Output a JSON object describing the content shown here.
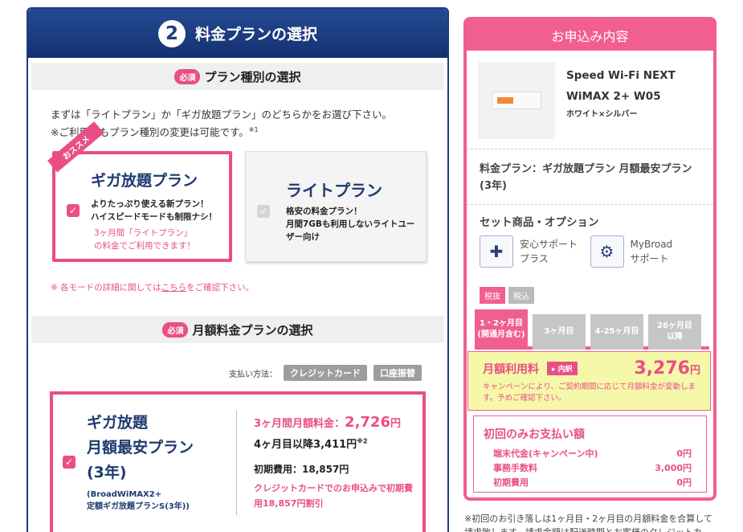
{
  "step": {
    "number": "2",
    "title": "料金プランの選択"
  },
  "plan_type_section": {
    "required_badge": "必須",
    "heading": "プラン種別の選択",
    "intro_line1": "まずは「ライトプラン」か「ギガ放題プラン」のどちらかをお選び下さい。",
    "intro_line2": "※ご利用中もプラン種別の変更は可能です。",
    "intro_sup": "※1",
    "giga": {
      "ribbon": "おススメ",
      "title": "ギガ放題プラン",
      "desc1": "よりたっぷり使える新プラン！",
      "desc2": "ハイスピードモードも制限ナシ！",
      "note1": "3ヶ月間「ライトプラン」",
      "note2": "の料金でご利用できます！",
      "selected": true
    },
    "lite": {
      "title": "ライトプラン",
      "desc1": "格安の料金プラン！",
      "desc2": "月間7GBも利用しないライトユー",
      "desc3": "ザー向け",
      "selected": false
    },
    "detail_note_prefix": "※ 各モードの詳細に関しては",
    "detail_note_link": "こちら",
    "detail_note_suffix": "をご確認下さい。"
  },
  "monthly_section": {
    "required_badge": "必須",
    "heading": "月額料金プランの選択",
    "pay_label": "支払い方法：",
    "pay_credit": "クレジットカード",
    "pay_bank": "口座振替",
    "plan": {
      "title1": "ギガ放題",
      "title2": "月額最安プラン",
      "title3": "(3年)",
      "sub1": "(BroadWiMAX2+",
      "sub2": "定額ギガ放題プランS(3年))",
      "price_label": "3ヶ月間月額料金：",
      "price_value": "2,726",
      "price_unit": "円",
      "after_label": "4ヶ月目以降3,411円",
      "after_sup": "※2",
      "init_fee": "初期費用：18,857円",
      "discount1": "クレジットカードでのお申込みで初期費",
      "discount2": "用18,857円割引",
      "selected": true
    }
  },
  "summary": {
    "title": "お申込み内容",
    "product_name1": "Speed Wi-Fi NEXT",
    "product_name2": "WiMAX 2+ W05",
    "product_color": "ホワイト×シルバー",
    "plan_label": "料金プラン：ギガ放題プラン 月額最安プラン(3年)",
    "options_title": "セット商品・オプション",
    "options": [
      {
        "label1": "安心サポート",
        "label2": "プラス",
        "icon": "support-icon"
      },
      {
        "label1": "MyBroad",
        "label2": "サポート",
        "icon": "mybroad-icon"
      }
    ],
    "tax_tabs": [
      "税抜",
      "税込"
    ],
    "month_tabs": [
      {
        "line1": "1・2ヶ月目",
        "line2": "(開通月含む)"
      },
      {
        "line1": "3ヶ月目",
        "line2": ""
      },
      {
        "line1": "4-25ヶ月目",
        "line2": ""
      },
      {
        "line1": "26ヶ月目",
        "line2": "以降"
      }
    ],
    "monthly_label": "月額利用料",
    "inner_badge": "内訳",
    "monthly_price": "3,276",
    "monthly_unit": "円",
    "monthly_note": "キャンペーンにより、ご契約期間に応じて月額料金が変動します。予めご確認下さい。",
    "first_title": "初回のみお支払い額",
    "fees": [
      {
        "label": "端末代金(キャンペーン中)",
        "value": "0円"
      },
      {
        "label": "事務手数料",
        "value": "3,000円"
      },
      {
        "label": "初期費用",
        "value": "0円"
      }
    ],
    "footnote": "※初回のお引き落しは1ヶ月目・2ヶ月目の月額料金を合算して請求致します。請求金額は配送時期とお客様のクレジットカ"
  },
  "colors": {
    "navy": "#1e3d7e",
    "pink": "#e94f86",
    "yellow": "#f5f8a8"
  }
}
